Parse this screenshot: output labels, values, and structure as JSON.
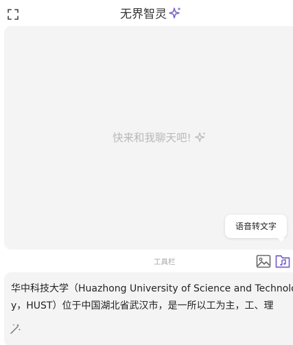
{
  "header": {
    "title": "无界智灵",
    "expand_icon": "expand-icon",
    "title_icon": "sparkle-icon",
    "accent_color": "#7b61c9"
  },
  "chat": {
    "empty_prompt": "快来和我聊天吧!",
    "empty_prompt_icon": "sparkle-icon",
    "tooltip": "语音转文字"
  },
  "toolbar": {
    "label": "工具栏",
    "image_button_icon": "image-icon",
    "audio_button_icon": "audio-file-icon"
  },
  "input": {
    "lines": [
      "华中科技大学（Huazhong University of Science and Technolo",
      "y，HUST）位于中国湖北省武汉市，是一所以工为主，工、理"
    ],
    "magic_icon": "magic-wand-icon"
  }
}
